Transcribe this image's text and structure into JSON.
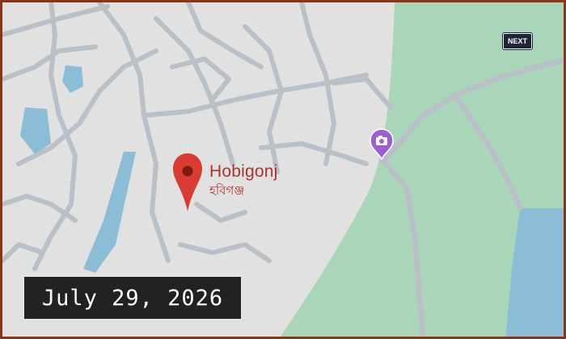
{
  "map": {
    "place_name": "Hobigonj",
    "place_name_local": "হবিগঞ্জ",
    "colors": {
      "land": "#e1e1e1",
      "road": "#b9c0c8",
      "water": "#8cbdd6",
      "park": "#a9d6b9",
      "pin": "#d93b33",
      "poi": "#9b5fd1"
    },
    "markers": [
      {
        "type": "location-pin",
        "label": "Hobigonj"
      },
      {
        "type": "camera-poi",
        "label": ""
      }
    ]
  },
  "overlay": {
    "date": "July 29, 2026",
    "logo": "NEXT"
  }
}
